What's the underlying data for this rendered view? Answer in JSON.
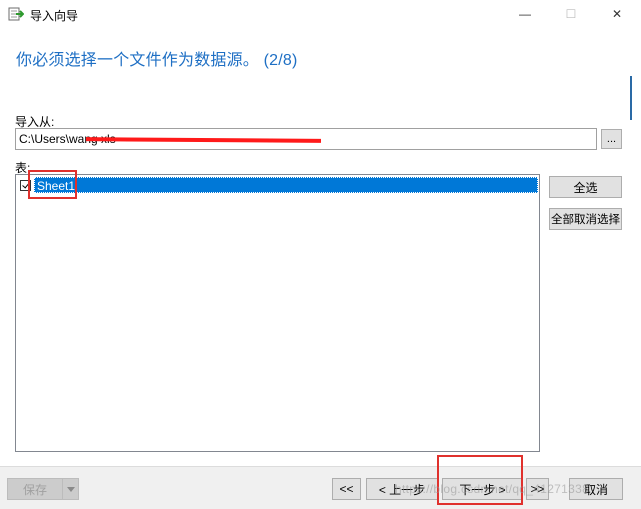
{
  "window": {
    "title": "导入向导",
    "minimize_glyph": "—",
    "maximize_glyph": "☐",
    "close_glyph": "✕",
    "icon": "import-wizard-icon"
  },
  "heading": "你必须选择一个文件作为数据源。 (2/8)",
  "import_from": {
    "label": "导入从:",
    "path": "C:\\Users\\wang                                                                    xls",
    "browse_label": "..."
  },
  "tables": {
    "label": "表:",
    "rows": [
      {
        "name": "Sheet1",
        "checked": true,
        "selected": true
      }
    ]
  },
  "side_buttons": {
    "select_all": "全选",
    "deselect_all": "全部取消选择"
  },
  "footer": {
    "save": "保存",
    "first": "<<",
    "prev": "< 上一步",
    "next": "下一步 >",
    "last": ">>",
    "cancel": "取消"
  },
  "watermark": "https://blog.csdn.net/qq_41271338",
  "colors": {
    "heading": "#1e6fc4",
    "selection": "#0078d7",
    "annotation": "#e0312d",
    "redaction": "#ff1a1a"
  }
}
